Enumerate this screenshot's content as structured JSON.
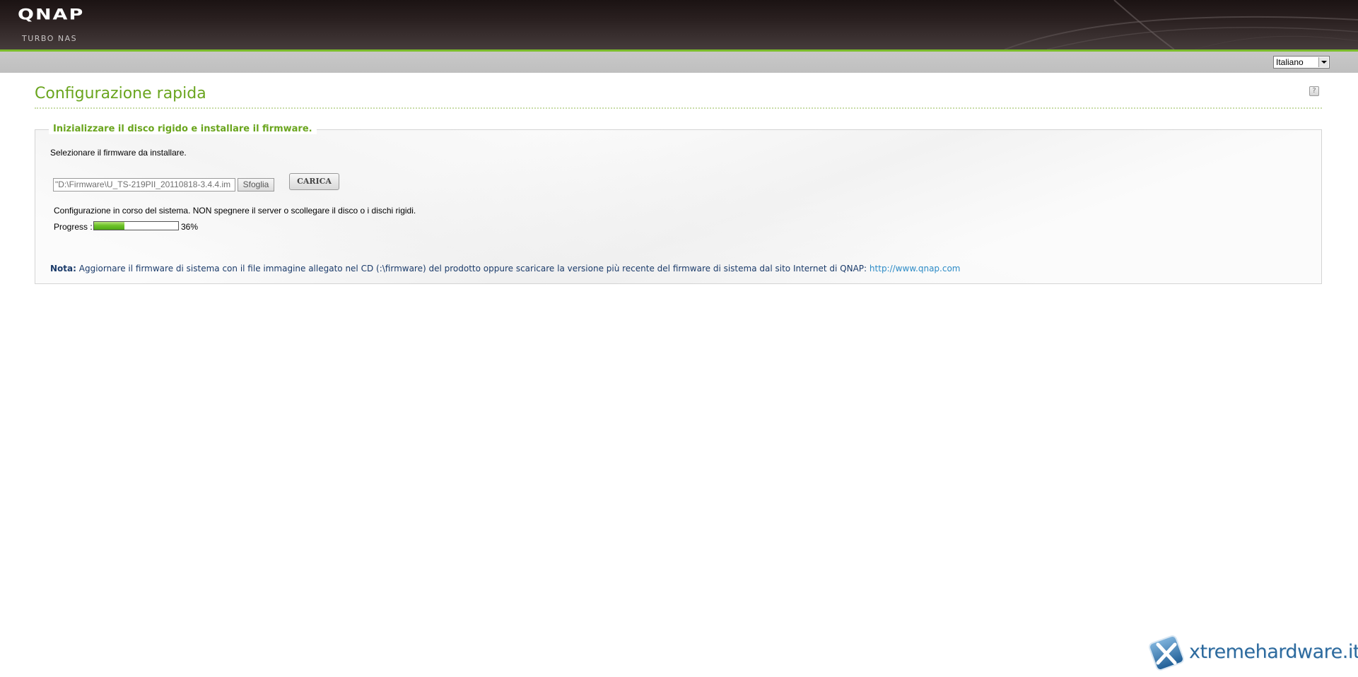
{
  "header": {
    "logo": "QNAP",
    "logo_subtitle": "TURBO NAS"
  },
  "language": {
    "selected": "Italiano"
  },
  "page": {
    "title": "Configurazione rapida"
  },
  "panel": {
    "legend": "Inizializzare il disco rigido e installare il firmware.",
    "instruction": "Selezionare il firmware da installare.",
    "file_value": "\"D:\\Firmware\\U_TS-219PII_20110818-3.4.4.im",
    "browse_label": "Sfoglia",
    "upload_label": "CARICA",
    "status_message": "Configurazione in corso del sistema. NON spegnere il server o scollegare il disco o i dischi rigidi.",
    "progress_label": "Progress :",
    "progress_value": 36,
    "progress_text": "36%",
    "note_label": "Nota:",
    "note_text": "Aggiornare il firmware di sistema con il file immagine allegato nel CD (:\\firmware) del prodotto oppure scaricare la versione più recente del firmware di sistema dal sito Internet di QNAP:",
    "note_link": "http://www.qnap.com"
  },
  "watermark": {
    "text": "xtremehardware.it"
  },
  "colors": {
    "accent_green": "#6aa51e",
    "header_dark": "#1b1313",
    "link_blue": "#2d8bc6"
  }
}
